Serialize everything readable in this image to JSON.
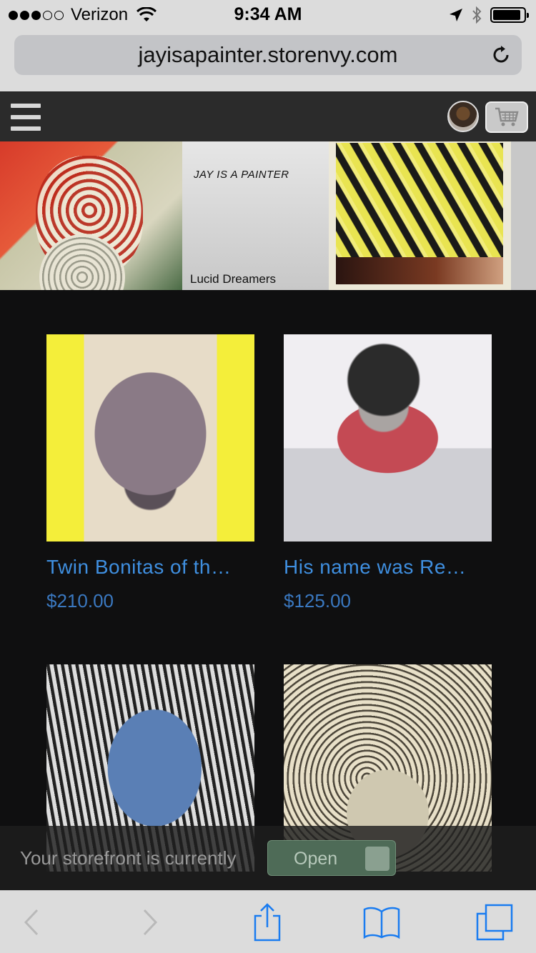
{
  "status_bar": {
    "carrier": "Verizon",
    "signal_bars_filled": 3,
    "signal_bars_total": 5,
    "time": "9:34 AM",
    "battery_level": 0.9
  },
  "browser": {
    "url": "jayisapainter.storenvy.com"
  },
  "banner": {
    "tagline": "JAY IS A PAINTER",
    "caption": "Lucid Dreamers"
  },
  "products": [
    {
      "title": "Twin Bonitas of th…",
      "price": "$210.00"
    },
    {
      "title": "His name was Re…",
      "price": "$125.00"
    },
    {
      "title": "",
      "price": ""
    },
    {
      "title": "",
      "price": ""
    }
  ],
  "notice": {
    "text": "Your storefront is currently",
    "button_label": "Open"
  },
  "colors": {
    "link": "#3f8fe0",
    "price": "#3a78c0",
    "page_bg": "#0f0f10",
    "header_bg": "#2b2b2b",
    "ios_blue": "#1a7cf0"
  }
}
